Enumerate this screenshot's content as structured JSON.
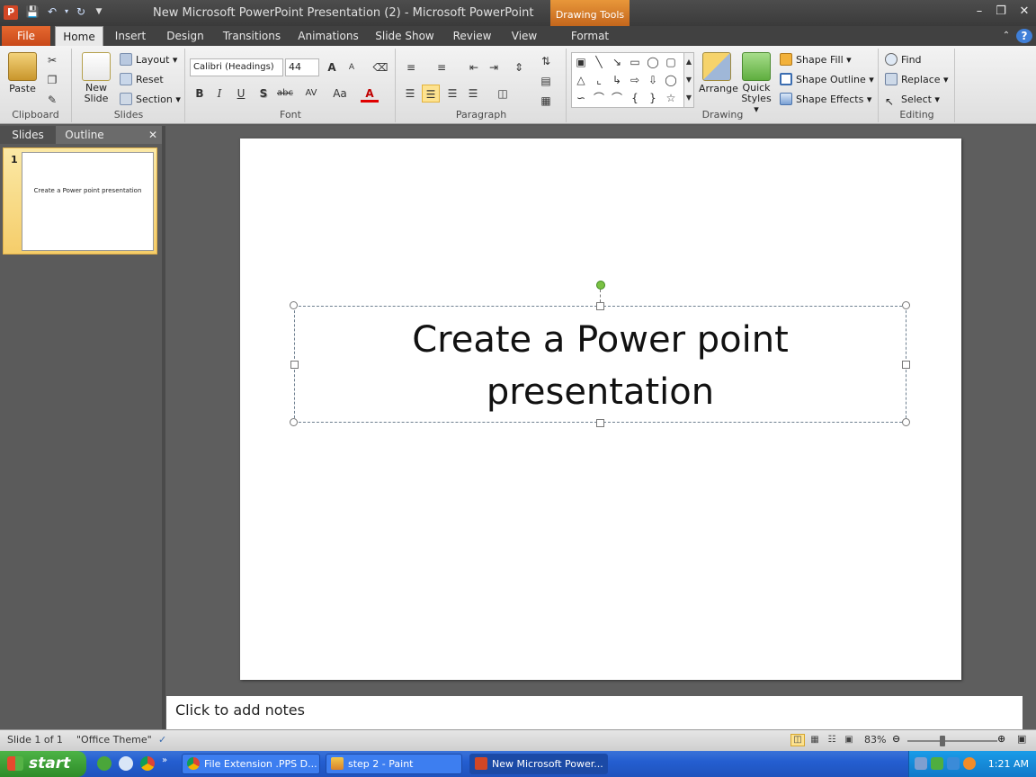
{
  "window": {
    "title": "New Microsoft PowerPoint Presentation (2)  -  Microsoft PowerPoint",
    "contextual_tab": "Drawing Tools",
    "app_icon_letter": "P"
  },
  "tabs": {
    "file": "File",
    "items": [
      "Home",
      "Insert",
      "Design",
      "Transitions",
      "Animations",
      "Slide Show",
      "Review",
      "View"
    ],
    "contextual": "Format",
    "active": "Home"
  },
  "ribbon": {
    "clipboard": {
      "label": "Clipboard",
      "paste": "Paste"
    },
    "slides": {
      "label": "Slides",
      "new_slide_line1": "New",
      "new_slide_line2": "Slide",
      "layout": "Layout",
      "reset": "Reset",
      "section": "Section"
    },
    "font": {
      "label": "Font",
      "font_name": "Calibri (Headings)",
      "font_size": "44",
      "bold": "B",
      "italic": "I",
      "underline": "U",
      "shadow": "S",
      "strike": "abc",
      "spacing": "AV",
      "case": "Aa",
      "color": "A",
      "grow": "A",
      "shrink": "A"
    },
    "paragraph": {
      "label": "Paragraph"
    },
    "drawing": {
      "label": "Drawing",
      "arrange": "Arrange",
      "quick_styles_line1": "Quick",
      "quick_styles_line2": "Styles",
      "shape_fill": "Shape Fill",
      "shape_outline": "Shape Outline",
      "shape_effects": "Shape Effects"
    },
    "editing": {
      "label": "Editing",
      "find": "Find",
      "replace": "Replace",
      "select": "Select"
    }
  },
  "left_pane": {
    "tab_slides": "Slides",
    "tab_outline": "Outline",
    "slide_number": "1",
    "thumb_text": "Create a Power point presentation"
  },
  "slide": {
    "title_line1": "Create a Power point",
    "title_line2": "presentation"
  },
  "notes": {
    "placeholder": "Click to add notes"
  },
  "status": {
    "slide_info": "Slide 1 of 1",
    "theme": "\"Office Theme\"",
    "zoom": "83%",
    "zoom_fraction": 0.39
  },
  "taskbar": {
    "start": "start",
    "tasks": [
      "File Extension .PPS D...",
      "step 2 - Paint",
      "New Microsoft Power..."
    ],
    "active_task": 2,
    "clock": "1:21 AM"
  },
  "colors": {
    "file_tab": "#d24726",
    "contextual": "#e8973a",
    "selected_thumb": "#f5cd6a",
    "rotation_handle": "#7ac143"
  }
}
